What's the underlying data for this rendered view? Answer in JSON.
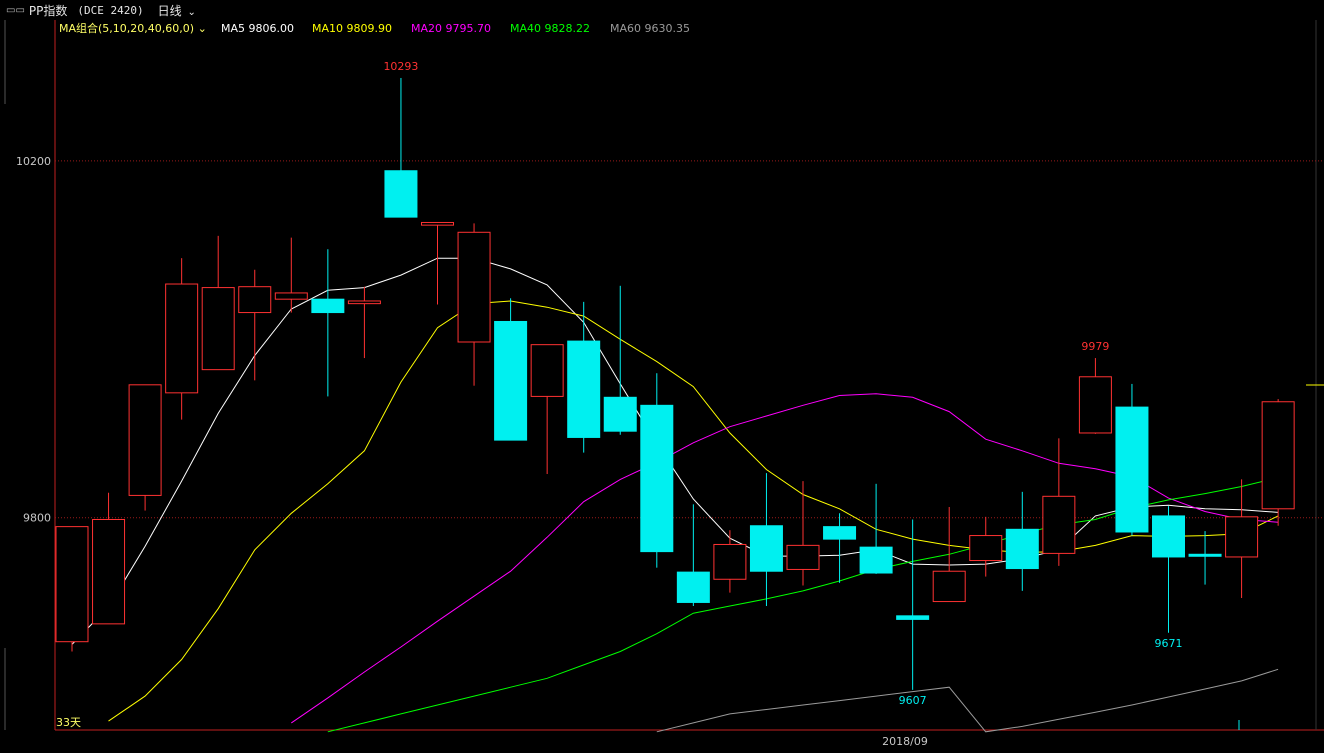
{
  "header": {
    "icon": "link-icon",
    "symbol": "PP指数",
    "exchange": "(DCE 2420)",
    "period": "日线"
  },
  "legend": {
    "group": {
      "label": "MA组合(5,10,20,40,60,0)",
      "color": "#ffff66"
    },
    "items": [
      {
        "name": "MA5",
        "value": "9806.00",
        "color": "#ffffff"
      },
      {
        "name": "MA10",
        "value": "9809.90",
        "color": "#ffff00"
      },
      {
        "name": "MA20",
        "value": "9795.70",
        "color": "#ff00ff"
      },
      {
        "name": "MA40",
        "value": "9828.22",
        "color": "#00ff00"
      },
      {
        "name": "MA60",
        "value": "9630.35",
        "color": "#9a9a9a"
      }
    ]
  },
  "chart_data": {
    "type": "candlestick",
    "y_ticks": [
      "10200",
      "9800"
    ],
    "ylim": [
      9562,
      10358
    ],
    "x_tick_label": "2018/09",
    "bottom_left_label": "33天",
    "up_color": "#ff3232",
    "down_color": "#00f0f0",
    "candles": [
      {
        "o": 9661,
        "h": 9685,
        "l": 9650,
        "c": 9790
      },
      {
        "o": 9681,
        "h": 9828,
        "l": 9681,
        "c": 9798
      },
      {
        "o": 9825,
        "h": 9946,
        "l": 9808,
        "c": 9949
      },
      {
        "o": 9940,
        "h": 10091,
        "l": 9910,
        "c": 10062
      },
      {
        "o": 9966,
        "h": 10116,
        "l": 9966,
        "c": 10058
      },
      {
        "o": 10030,
        "h": 10078,
        "l": 9954,
        "c": 10059
      },
      {
        "o": 10045,
        "h": 10114,
        "l": 10030,
        "c": 10052
      },
      {
        "o": 10045,
        "h": 10101,
        "l": 9936,
        "c": 10030
      },
      {
        "o": 10040,
        "h": 10059,
        "l": 9979,
        "c": 10043
      },
      {
        "o": 10189,
        "h": 10293,
        "l": 10150,
        "c": 10137
      },
      {
        "o": 10128,
        "h": 10126,
        "l": 10039,
        "c": 10131
      },
      {
        "o": 9997,
        "h": 10130,
        "l": 9948,
        "c": 10120
      },
      {
        "o": 10020,
        "h": 10046,
        "l": 9934,
        "c": 9887
      },
      {
        "o": 9936,
        "h": 9971,
        "l": 9849,
        "c": 9994
      },
      {
        "o": 9998,
        "h": 10042,
        "l": 9873,
        "c": 9890
      },
      {
        "o": 9935,
        "h": 10060,
        "l": 9893,
        "c": 9897
      },
      {
        "o": 9926,
        "h": 9962,
        "l": 9744,
        "c": 9762
      },
      {
        "o": 9739,
        "h": 9815,
        "l": 9701,
        "c": 9705
      },
      {
        "o": 9731,
        "h": 9786,
        "l": 9716,
        "c": 9770
      },
      {
        "o": 9791,
        "h": 9850,
        "l": 9701,
        "c": 9740
      },
      {
        "o": 9742,
        "h": 9841,
        "l": 9724,
        "c": 9769
      },
      {
        "o": 9790,
        "h": 9805,
        "l": 9727,
        "c": 9776
      },
      {
        "o": 9767,
        "h": 9838,
        "l": 9737,
        "c": 9738
      },
      {
        "o": 9690,
        "h": 9798,
        "l": 9607,
        "c": 9686
      },
      {
        "o": 9706,
        "h": 9812,
        "l": 9711,
        "c": 9740
      },
      {
        "o": 9752,
        "h": 9801,
        "l": 9734,
        "c": 9780
      },
      {
        "o": 9787,
        "h": 9829,
        "l": 9718,
        "c": 9743
      },
      {
        "o": 9760,
        "h": 9889,
        "l": 9746,
        "c": 9824
      },
      {
        "o": 9895,
        "h": 9979,
        "l": 9894,
        "c": 9958
      },
      {
        "o": 9924,
        "h": 9950,
        "l": 9780,
        "c": 9784
      },
      {
        "o": 9802,
        "h": 9813,
        "l": 9671,
        "c": 9756
      },
      {
        "o": 9759,
        "h": 9785,
        "l": 9725,
        "c": 9757
      },
      {
        "o": 9756,
        "h": 9843,
        "l": 9710,
        "c": 9801
      },
      {
        "o": 9810,
        "h": 9933,
        "l": 9791,
        "c": 9930
      }
    ],
    "ma5": [
      9658,
      9700,
      9768,
      9841,
      9917,
      9982,
      10034,
      10055,
      10058,
      10072,
      10091,
      10091,
      10079,
      10061,
      10019,
      9950,
      9883,
      9821,
      9777,
      9757,
      9757,
      9758,
      9764,
      9748,
      9747,
      9748,
      9754,
      9764,
      9802,
      9812,
      9814,
      9810,
      9809,
      9806
    ],
    "ma10": [
      9544,
      9572,
      9600,
      9641,
      9698,
      9764,
      9805,
      9838,
      9875,
      9952,
      10013,
      10040,
      10043,
      10036,
      10026,
      10000,
      9975,
      9947,
      9895,
      9854,
      9826,
      9810,
      9787,
      9776,
      9769,
      9764,
      9761,
      9762,
      9769,
      9780,
      9779,
      9780,
      9782,
      9802
    ],
    "ma20": [
      9400,
      9428,
      9456,
      9484,
      9513,
      9542,
      9570,
      9598,
      9627,
      9655,
      9684,
      9712,
      9740,
      9778,
      9818,
      9843,
      9862,
      9884,
      9902,
      9914,
      9926,
      9937,
      9939,
      9935,
      9919,
      9888,
      9875,
      9861,
      9855,
      9846,
      9822,
      9807,
      9798,
      9795
    ],
    "ma40": [
      9490,
      9500,
      9510,
      9520,
      9530,
      9540,
      9550,
      9560,
      9570,
      9580,
      9590,
      9600,
      9610,
      9620,
      9635,
      9650,
      9670,
      9693,
      9701,
      9709,
      9718,
      9729,
      9742,
      9751,
      9759,
      9770,
      9782,
      9792,
      9798,
      9811,
      9820,
      9827,
      9835,
      9845
    ],
    "ma60": [
      9400,
      9410,
      9420,
      9430,
      9440,
      9450,
      9460,
      9470,
      9480,
      9490,
      9500,
      9510,
      9520,
      9530,
      9540,
      9550,
      9560,
      9570,
      9580,
      9585,
      9590,
      9595,
      9600,
      9605,
      9610,
      9560,
      9566,
      9574,
      9582,
      9590,
      9599,
      9608,
      9617,
      9630
    ],
    "annotations": [
      {
        "text": "10293",
        "candle": 9,
        "price": 10293,
        "pos": "above",
        "color": "#ff3232"
      },
      {
        "text": "9979",
        "candle": 28,
        "price": 9979,
        "pos": "above",
        "color": "#ff3232"
      },
      {
        "text": "9607",
        "candle": 23,
        "price": 9607,
        "pos": "below",
        "color": "#00f0f0"
      },
      {
        "text": "9671",
        "candle": 30,
        "price": 9671,
        "pos": "below",
        "color": "#00f0f0"
      }
    ]
  }
}
